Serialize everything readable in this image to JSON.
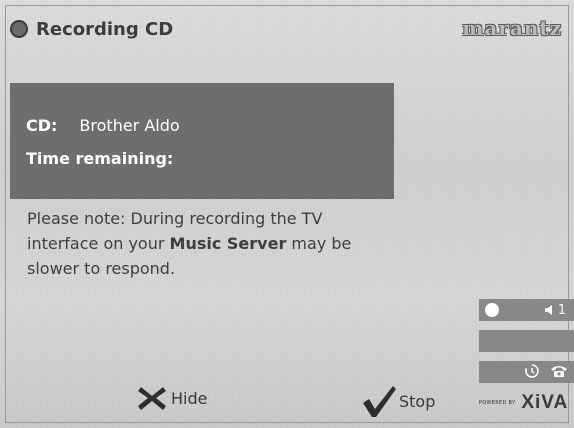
{
  "header": {
    "title": "Recording CD",
    "brand": "marantz",
    "record_icon": "record-dot-icon"
  },
  "info": {
    "cd_label": "CD:",
    "cd_value": "Brother Aldo",
    "time_label": "Time remaining:",
    "time_value": ""
  },
  "note": {
    "part1": "Please note: During recording the TV interface on your ",
    "bold": "Music Server",
    "part2": " may be slower to respond."
  },
  "status": {
    "volume_value": "1",
    "icons": [
      "circle-indicator-icon",
      "speaker-icon",
      "timer-icon",
      "phone-icon"
    ]
  },
  "footer": {
    "hide_label": "Hide",
    "stop_label": "Stop",
    "powered_by": "POWERED BY",
    "xiva": "XiVA"
  },
  "colors": {
    "panel": "#6e6e6e",
    "background": "#d4d4d4",
    "text": "#3e3e3e"
  }
}
